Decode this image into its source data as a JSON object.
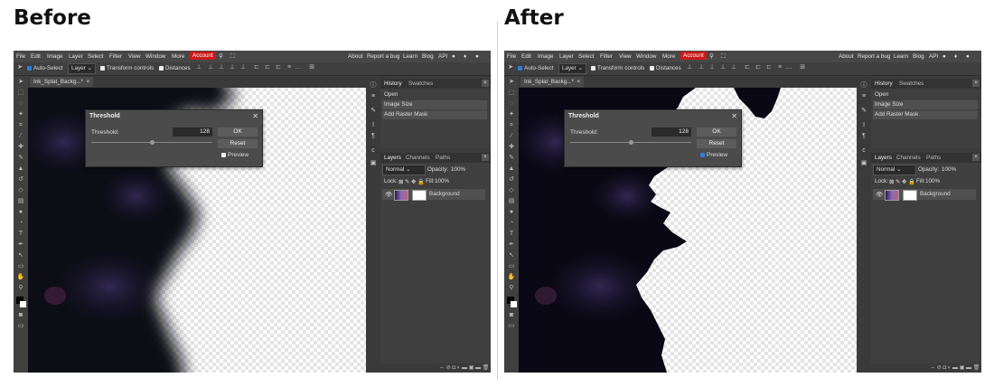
{
  "labels": {
    "before": "Before",
    "after": "After"
  },
  "colors": {
    "account": "#cc1a1a",
    "checkbox_on": "#2f7de0",
    "ink": "#0a0814"
  },
  "menu": {
    "file": "File",
    "edit": "Edit",
    "image": "Image",
    "layer": "Layer",
    "select": "Select",
    "filter": "Filter",
    "view": "View",
    "window": "Window",
    "more": "More",
    "account": "Account",
    "about": "About",
    "report": "Report a bug",
    "learn": "Learn",
    "blog": "Blog",
    "api": "API"
  },
  "options": {
    "auto_select": "Auto-Select",
    "layer_select": "Layer",
    "transform": "Transform controls",
    "distances": "Distances"
  },
  "document": {
    "tab_title": "Ink_Splat_Backg...*",
    "close": "×"
  },
  "history": {
    "tab": "History",
    "swatches_tab": "Swatches",
    "items": [
      "Open",
      "Image Size",
      "Add Raster Mask"
    ]
  },
  "layers": {
    "tab": "Layers",
    "channels_tab": "Channels",
    "paths_tab": "Paths",
    "blend_mode": "Normal",
    "opacity_label": "Opacity:",
    "opacity_value": "100%",
    "lock_label": "Lock:",
    "fill_label": "Fill:",
    "fill_value": "100%",
    "layer_name": "Background"
  },
  "threshold": {
    "title": "Threshold",
    "label": "Threshold:",
    "value": "128",
    "ok": "OK",
    "reset": "Reset",
    "preview": "Preview"
  },
  "panels": {
    "before": {
      "preview_checked": false
    },
    "after": {
      "preview_checked": true
    }
  }
}
